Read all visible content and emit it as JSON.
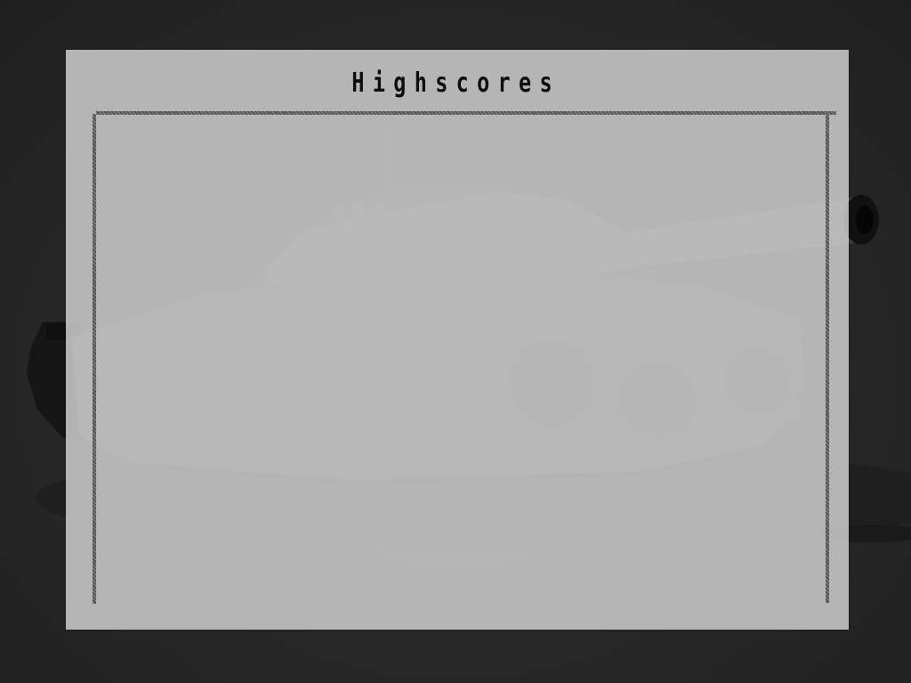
{
  "screen": {
    "title": "Highscores"
  },
  "background": {
    "art": "tank-illustration"
  },
  "scores": {
    "entries": []
  },
  "colors": {
    "backdrop": "#262626",
    "panel": "#cdcdcd",
    "title_text": "#0d0d0d",
    "frame": "#6a6a6a"
  }
}
